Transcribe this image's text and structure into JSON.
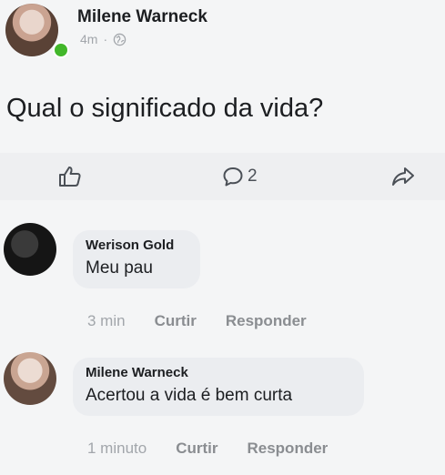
{
  "post": {
    "author": "Milene Warneck",
    "time": "4m",
    "separator": "·",
    "text": "Qual o significado da vida?",
    "comment_count": "2"
  },
  "icons": {
    "like": "thumbs-up-icon",
    "comment": "speech-bubble-icon",
    "share": "share-arrow-icon",
    "privacy": "globe-icon"
  },
  "colors": {
    "online": "#42b72a",
    "bubble": "#ebedf0",
    "muted": "#a2a6ab"
  },
  "comments": [
    {
      "author": "Werison Gold",
      "text": "Meu pau",
      "time": "3 min",
      "like_label": "Curtir",
      "reply_label": "Responder"
    },
    {
      "author": "Milene Warneck",
      "text": "Acertou a vida é bem curta",
      "time": "1 minuto",
      "like_label": "Curtir",
      "reply_label": "Responder"
    }
  ]
}
